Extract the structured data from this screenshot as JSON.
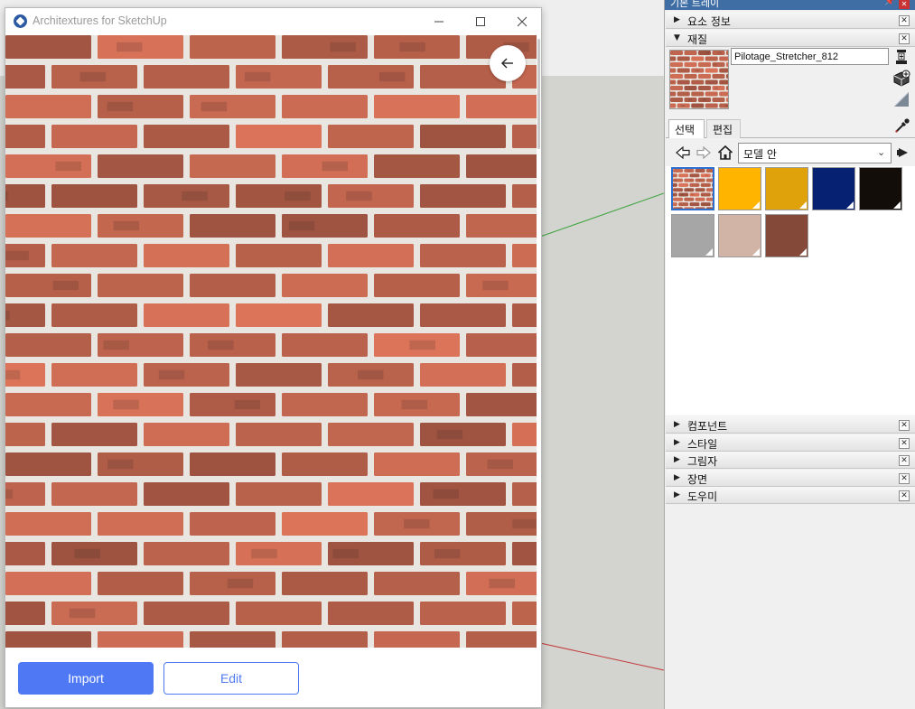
{
  "window": {
    "title": "Architextures for SketchUp",
    "import_label": "Import",
    "edit_label": "Edit"
  },
  "tray": {
    "title": "기본 트레이",
    "panels_top": [
      {
        "label": "요소 정보",
        "expanded": false
      },
      {
        "label": "재질",
        "expanded": true
      }
    ],
    "material_name": "Pilotage_Stretcher_812",
    "tabs": [
      {
        "label": "선택",
        "active": true
      },
      {
        "label": "편집",
        "active": false
      }
    ],
    "collection": "모델 안",
    "swatches": [
      {
        "kind": "brick",
        "color": "#b5573e",
        "selected": true
      },
      {
        "kind": "color",
        "color": "#ffb400",
        "selected": false
      },
      {
        "kind": "color",
        "color": "#e0a20b",
        "selected": false
      },
      {
        "kind": "color",
        "color": "#062171",
        "selected": false
      },
      {
        "kind": "color",
        "color": "#120d08",
        "selected": false
      },
      {
        "kind": "color",
        "color": "#a6a6a6",
        "selected": false
      },
      {
        "kind": "color",
        "color": "#d1b4a5",
        "selected": false
      },
      {
        "kind": "color",
        "color": "#85493a",
        "selected": false
      }
    ],
    "panels_bottom": [
      {
        "label": "컴포넌트"
      },
      {
        "label": "스타일"
      },
      {
        "label": "그림자"
      },
      {
        "label": "장면"
      },
      {
        "label": "도우미"
      }
    ]
  },
  "colors": {
    "accent": "#4f79f4",
    "brick_base": "#c96a52",
    "mortar": "#e9e6e1",
    "tray_header": "#3f6ea5",
    "axis_green": "#3aa33a",
    "axis_red": "#c23a3a"
  }
}
